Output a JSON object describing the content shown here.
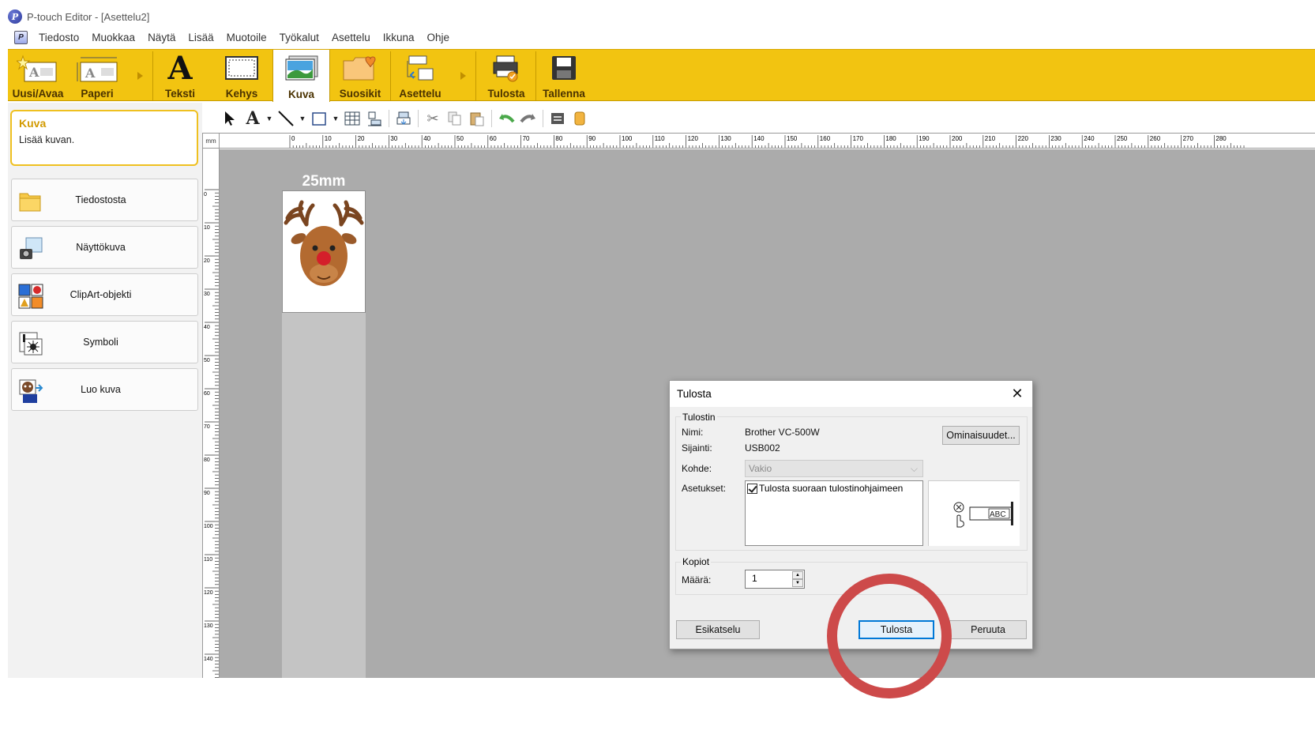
{
  "window": {
    "title": "P-touch Editor - [Asettelu2]",
    "logo_glyph": "P"
  },
  "menubar": {
    "items": [
      "Tiedosto",
      "Muokkaa",
      "Näytä",
      "Lisää",
      "Muotoile",
      "Työkalut",
      "Asettelu",
      "Ikkuna",
      "Ohje"
    ]
  },
  "ribbon": {
    "buttons": [
      {
        "label": "Uusi/Avaa",
        "icon": "new-open-icon"
      },
      {
        "label": "Paperi",
        "icon": "paper-icon"
      },
      {
        "label": "Teksti",
        "icon": "text-icon",
        "glyph": "A"
      },
      {
        "label": "Kehys",
        "icon": "frame-icon"
      },
      {
        "label": "Kuva",
        "icon": "image-icon",
        "active": true
      },
      {
        "label": "Suosikit",
        "icon": "favorites-icon"
      },
      {
        "label": "Asettelu",
        "icon": "layout-icon"
      },
      {
        "label": "Tulosta",
        "icon": "print-icon"
      },
      {
        "label": "Tallenna",
        "icon": "save-icon"
      }
    ],
    "color": "#f2c411"
  },
  "side_panel": {
    "info_title": "Kuva",
    "info_desc": "Lisää kuvan.",
    "buttons": [
      {
        "label": "Tiedostosta",
        "icon": "folder-icon"
      },
      {
        "label": "Näyttökuva",
        "icon": "screenshot-camera-icon"
      },
      {
        "label": "ClipArt-objekti",
        "icon": "clipart-icon"
      },
      {
        "label": "Symboli",
        "icon": "symbol-icon"
      },
      {
        "label": "Luo kuva",
        "icon": "create-image-icon"
      }
    ]
  },
  "toolbar": {
    "text_tool_glyph": "A",
    "tools": [
      "select-arrow-icon",
      "text-tool-icon",
      "line-tool-icon",
      "rectangle-tool-icon",
      "table-icon",
      "align-icon",
      "arrange-icon",
      "cut-icon",
      "copy-icon",
      "paste-icon",
      "undo-icon",
      "redo-icon",
      "properties-icon",
      "database-icon"
    ]
  },
  "rulers": {
    "unit": "mm",
    "h_labels": [
      "0",
      "10",
      "20",
      "30",
      "40",
      "50",
      "60",
      "70",
      "80",
      "90",
      "100",
      "110",
      "120",
      "130",
      "140",
      "150",
      "160",
      "170",
      "180",
      "190",
      "200",
      "210",
      "220",
      "230",
      "240",
      "250",
      "260",
      "270",
      "280"
    ],
    "v_labels": [
      "0",
      "10",
      "20",
      "30",
      "40",
      "50",
      "60",
      "70",
      "80",
      "90",
      "100",
      "110",
      "120",
      "130",
      "140"
    ]
  },
  "canvas": {
    "tape_width_label": "25mm",
    "image": "reindeer-clipart"
  },
  "print_dialog": {
    "title": "Tulosta",
    "printer_group": "Tulostin",
    "name_label": "Nimi:",
    "name_value": "Brother VC-500W",
    "location_label": "Sijainti:",
    "location_value": "USB002",
    "properties_button": "Ominaisuudet...",
    "target_label": "Kohde:",
    "target_value": "Vakio",
    "settings_label": "Asetukset:",
    "setting_item": "Tulosta suoraan tulostinohjaimeen",
    "setting_checked": true,
    "preview_text": "ABC",
    "copies_group": "Kopiot",
    "count_label": "Määrä:",
    "count_value": "1",
    "preview_button": "Esikatselu",
    "print_button": "Tulosta",
    "cancel_button": "Peruuta"
  },
  "highlight_color": "#cd4a4a"
}
